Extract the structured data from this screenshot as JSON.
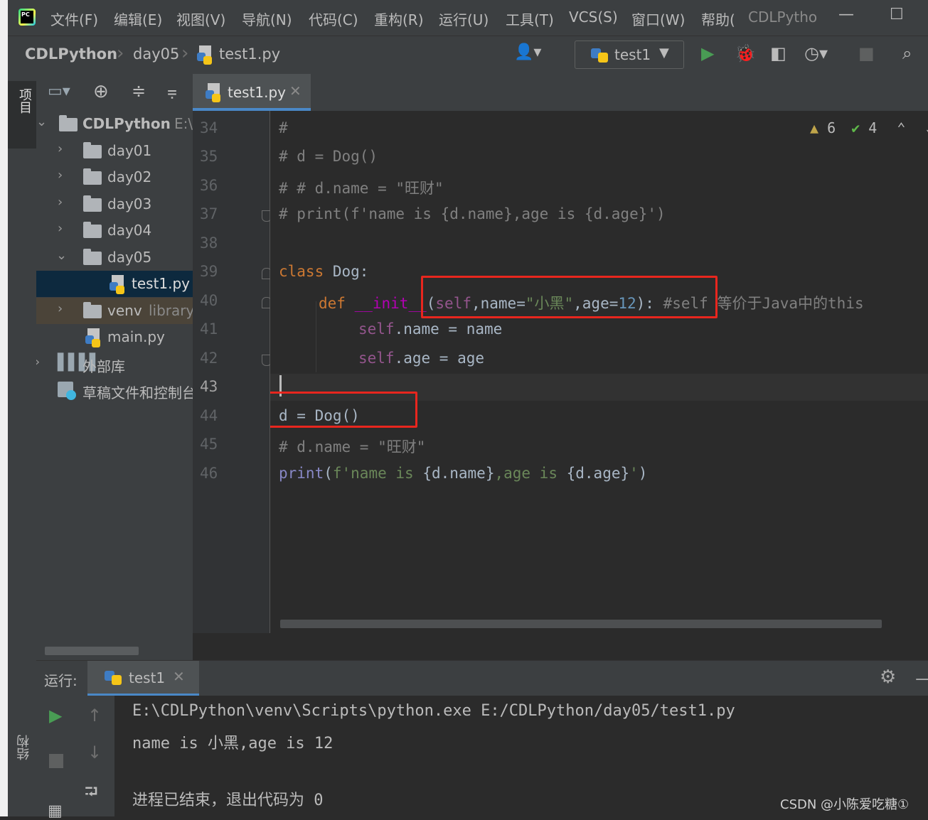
{
  "menu": {
    "items": [
      "文件(F)",
      "编辑(E)",
      "视图(V)",
      "导航(N)",
      "代码(C)",
      "重构(R)",
      "运行(U)",
      "工具(T)",
      "VCS(S)",
      "窗口(W)",
      "帮助("
    ],
    "title": "CDLPytho",
    "logo_text": "PC",
    "minimize": "—",
    "maximize": "☐"
  },
  "breadcrumb": [
    "CDLPython",
    "day05",
    "test1.py"
  ],
  "run_config": {
    "label": "test1"
  },
  "left_strip": {
    "project_label": "项目",
    "structure_label": "结构"
  },
  "project_tree": [
    {
      "label": "CDLPython",
      "suffix": "E:\\"
    },
    {
      "label": "day01"
    },
    {
      "label": "day02"
    },
    {
      "label": "day03"
    },
    {
      "label": "day04"
    },
    {
      "label": "day05"
    },
    {
      "label": "test1.py"
    },
    {
      "label": "venv",
      "suffix": "library"
    },
    {
      "label": "main.py"
    },
    {
      "label": "外部库"
    },
    {
      "label": "草稿文件和控制台"
    }
  ],
  "editor": {
    "tab_label": "test1.py",
    "line_numbers": [
      "34",
      "35",
      "36",
      "37",
      "38",
      "39",
      "40",
      "41",
      "42",
      "43",
      "44",
      "45",
      "46"
    ],
    "warnings": "6",
    "checks": "4",
    "code": {
      "l34": "#",
      "l35": "# d = Dog()",
      "l36": "# # d.name = \"旺财\"",
      "l37": "# print(f'name is {d.name},age is {d.age}')",
      "l39_kw": "class",
      "l39_rest": " Dog:",
      "l40_kw": "def",
      "l40_fn": "__init__",
      "l40_p1": "(",
      "l40_self": "self",
      "l40_p2": ",name=",
      "l40_str": "\"小黑\"",
      "l40_p3": ",age=",
      "l40_num": "12",
      "l40_p4": "): ",
      "l40_com": "#self 等价于Java中的this",
      "l41_self": "self",
      "l41_rest": ".name = name",
      "l42_self": "self",
      "l42_rest": ".age = age",
      "l44": "d = Dog()",
      "l45": "# d.name = \"旺财\"",
      "l46_fn": "print",
      "l46_a": "(",
      "l46_str1": "f'name is ",
      "l46_b": "{d.name}",
      "l46_str2": ",age is ",
      "l46_c": "{d.age}",
      "l46_str3": "'",
      "l46_d": ")"
    }
  },
  "run_panel": {
    "title": "运行:",
    "tab_label": "test1",
    "output": [
      "E:\\CDLPython\\venv\\Scripts\\python.exe E:/CDLPython/day05/test1.py",
      "name is 小黑,age is 12",
      "",
      "进程已结束，退出代码为 0"
    ]
  },
  "watermark": "CSDN @小陈爱吃糖①",
  "colors": {
    "keyword": "#cc7832",
    "string": "#6a8759",
    "number": "#6897bb",
    "self": "#94558d",
    "comment": "#808080",
    "highlight_box": "#e8261e",
    "accent": "#4a88c7"
  }
}
